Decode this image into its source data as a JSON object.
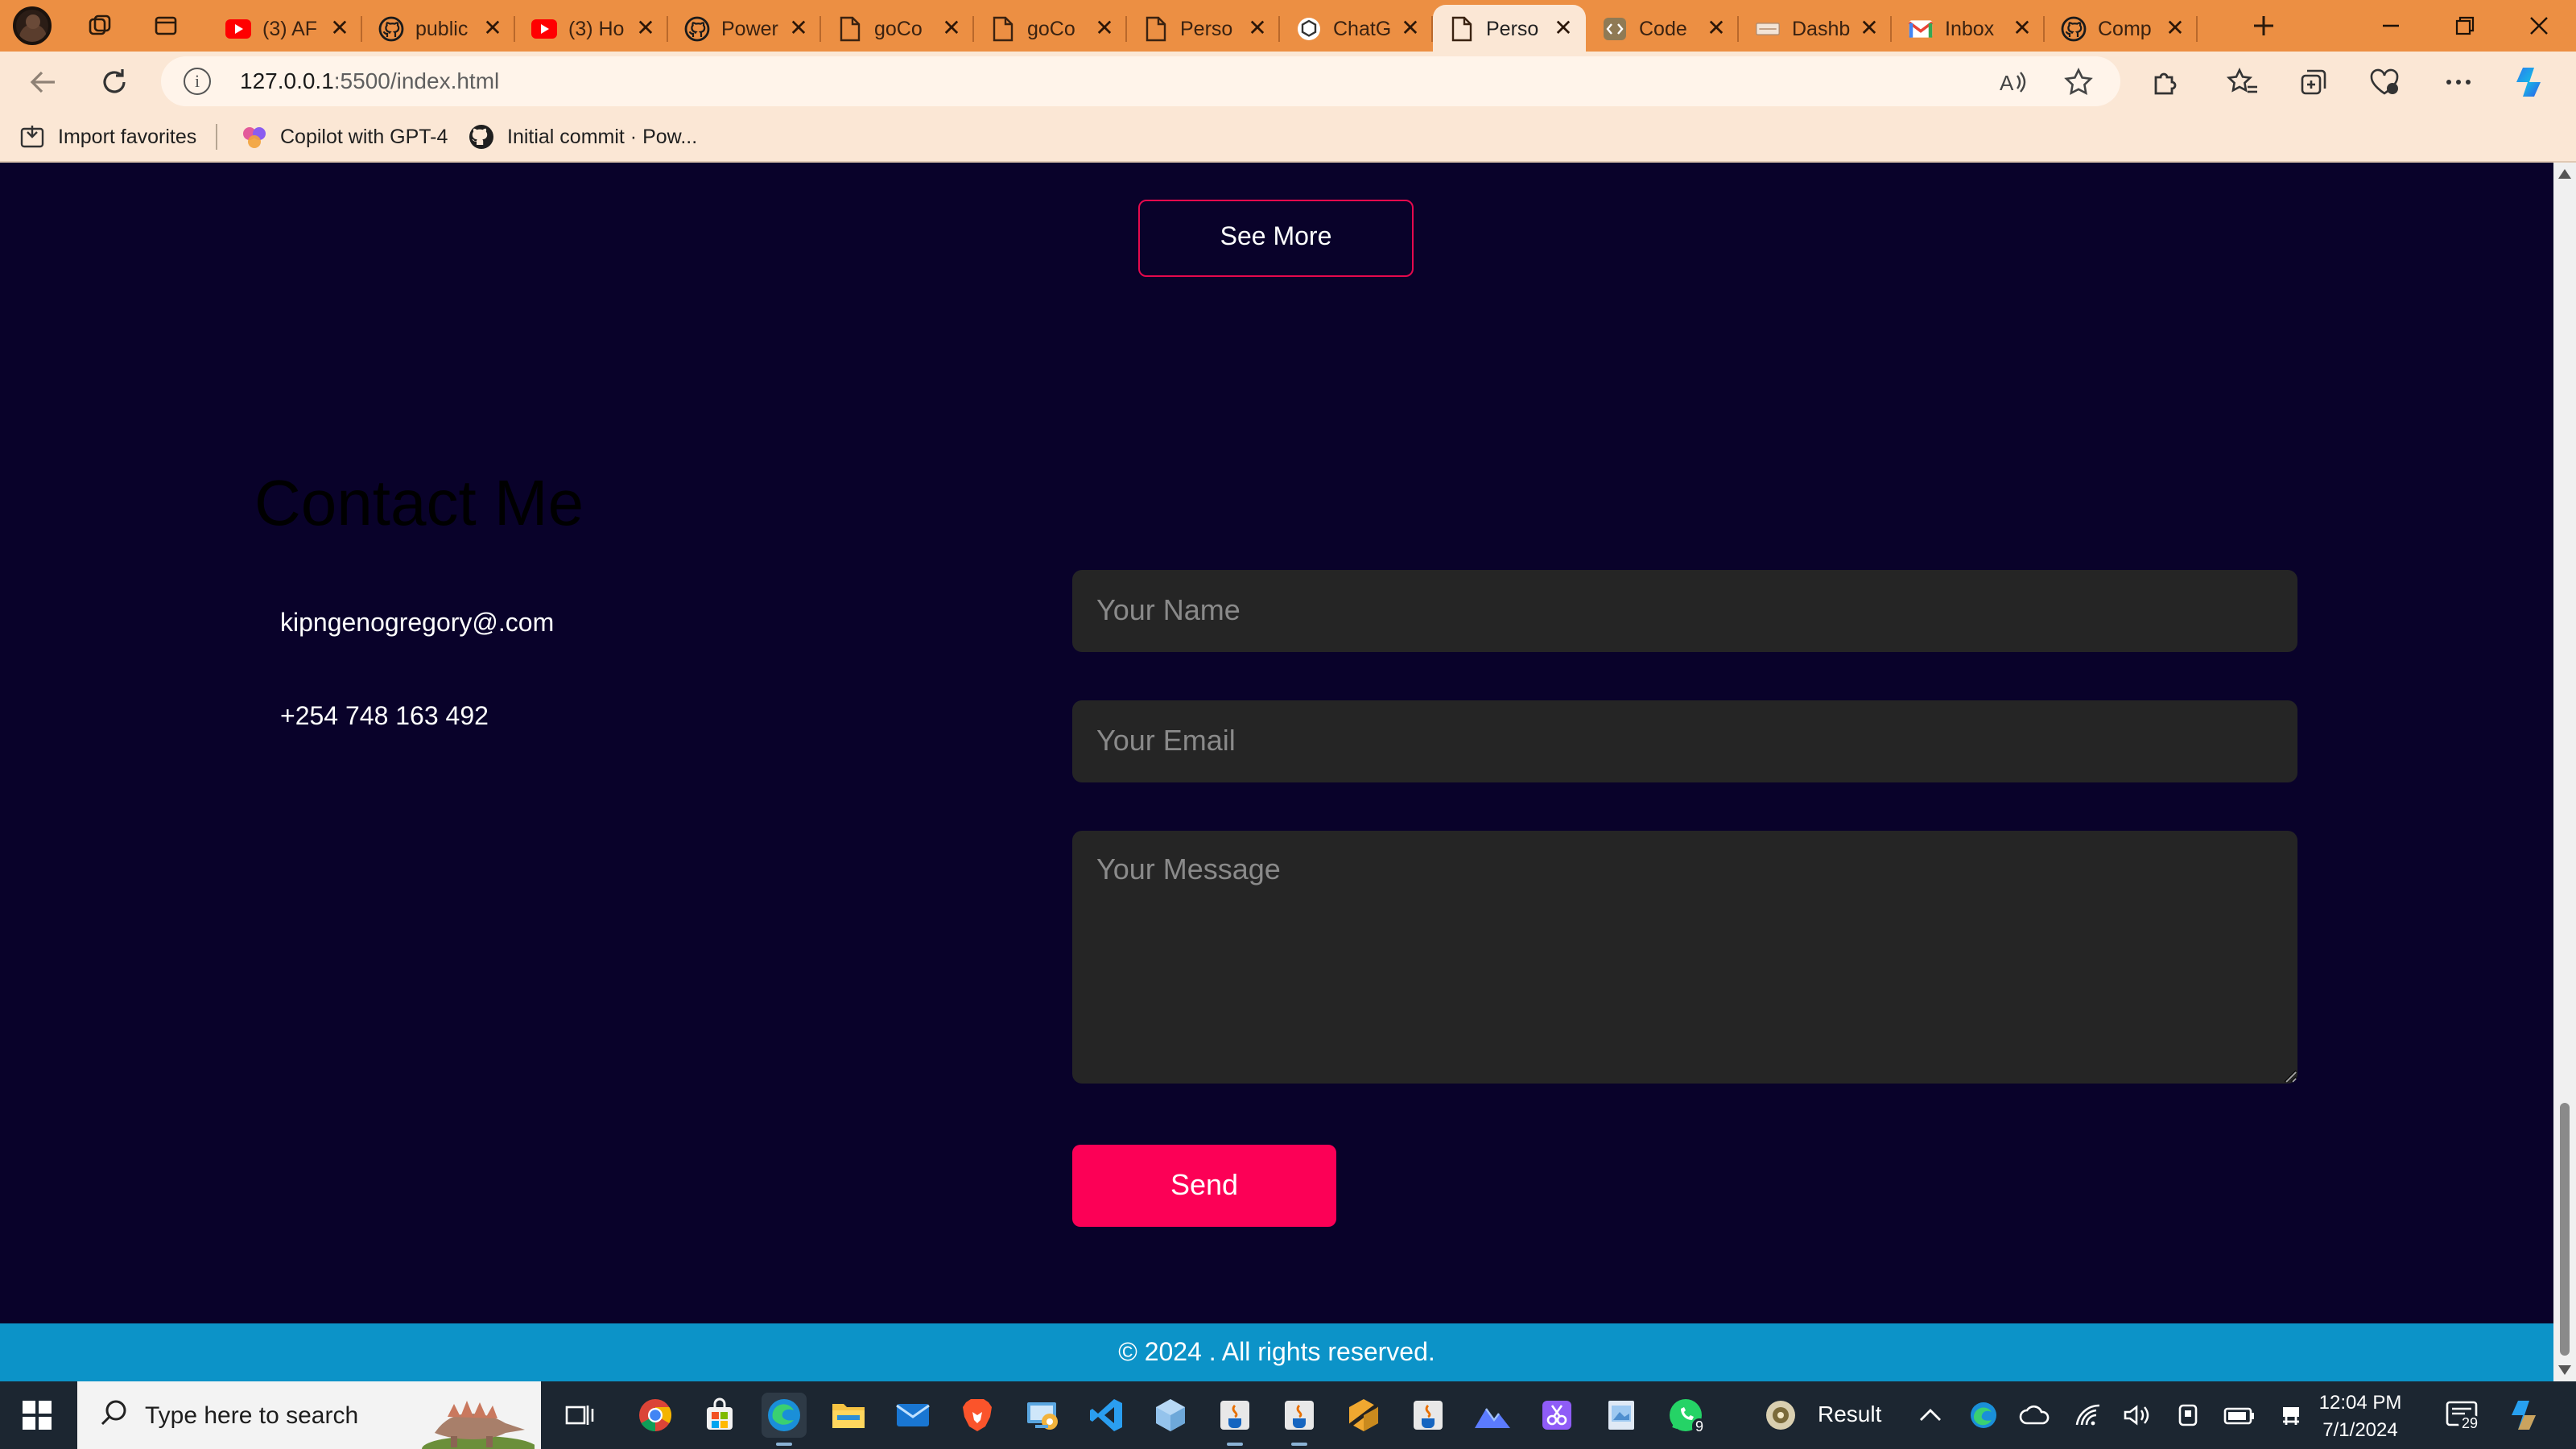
{
  "browser": {
    "tabs": [
      {
        "label": "(3) AF",
        "icon": "youtube-icon"
      },
      {
        "label": "public",
        "icon": "github-icon"
      },
      {
        "label": "(3) Ho",
        "icon": "youtube-icon"
      },
      {
        "label": "Power",
        "icon": "github-icon"
      },
      {
        "label": "goCo",
        "icon": "page-icon"
      },
      {
        "label": "goCo",
        "icon": "page-icon"
      },
      {
        "label": "Perso",
        "icon": "page-icon"
      },
      {
        "label": "ChatG",
        "icon": "chatgpt-icon"
      },
      {
        "label": "Perso",
        "icon": "page-icon"
      },
      {
        "label": "Code",
        "icon": "code-icon"
      },
      {
        "label": "Dashb",
        "icon": "dashboard-icon"
      },
      {
        "label": "Inbox",
        "icon": "gmail-icon"
      },
      {
        "label": "Comp",
        "icon": "github-icon"
      }
    ],
    "active_tab_index": 8,
    "url_host": "127.0.0.1",
    "url_path": ":5500/index.html",
    "favorites": {
      "import_label": "Import favorites",
      "copilot_label": "Copilot with GPT-4",
      "commit_label": "Initial commit · Pow..."
    }
  },
  "page": {
    "see_more_label": "See More",
    "contact_title": "Contact Me",
    "email": "kipngenogregory@.com",
    "phone": "+254 748 163 492",
    "form": {
      "name_placeholder": "Your Name",
      "email_placeholder": "Your Email",
      "message_placeholder": "Your Message",
      "send_label": "Send"
    },
    "footer_text": "© 2024 . All rights reserved."
  },
  "taskbar": {
    "search_placeholder": "Type here to search",
    "result_label": "Result",
    "time": "12:04 PM",
    "date": "7/1/2024",
    "whatsapp_badge": "9",
    "notifications_badge": "29"
  },
  "colors": {
    "page_background": "#09022a",
    "accent": "#fc0056",
    "footer": "#0c93c8",
    "input_background": "#252525",
    "browser_chrome": "#ec8f43"
  }
}
